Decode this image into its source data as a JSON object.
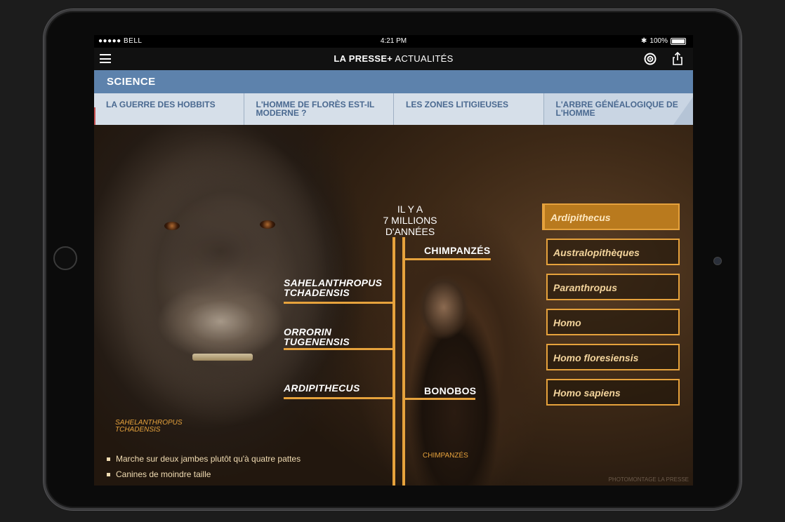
{
  "status_bar": {
    "carrier": "●●●●● BELL",
    "time": "4:21 PM",
    "battery": "100%"
  },
  "app_bar": {
    "brand_bold": "LA PRESSE+",
    "brand_light": " ACTUALITÉS"
  },
  "section": {
    "title": "SCIENCE"
  },
  "tabs": [
    {
      "label": "LA GUERRE DES HOBBITS"
    },
    {
      "label": "L'HOMME DE FLORÈS EST-IL MODERNE ?"
    },
    {
      "label": "LES ZONES LITIGIEUSES"
    },
    {
      "label": "L'ARBRE GÉNÉALOGIQUE DE L'HOMME"
    }
  ],
  "tree": {
    "root_label_line1": "IL Y A",
    "root_label_line2": "7 MILLIONS",
    "root_label_line3": "D'ANNÉES",
    "branches_left": [
      {
        "line1": "SAHELANTHROPUS",
        "line2": "TCHADENSIS"
      },
      {
        "line1": "ORRORIN",
        "line2": "TUGENENSIS"
      },
      {
        "line1": "ARDIPITHECUS",
        "line2": ""
      }
    ],
    "branches_right": [
      {
        "label": "CHIMPANZÉS"
      },
      {
        "label": "BONOBOS"
      }
    ]
  },
  "genus_list": [
    {
      "label": "Ardipithecus",
      "active": true
    },
    {
      "label": "Australopithèques",
      "active": false
    },
    {
      "label": "Paranthropus",
      "active": false
    },
    {
      "label": "Homo",
      "active": false
    },
    {
      "label": "Homo floresiensis",
      "active": false
    },
    {
      "label": "Homo sapiens",
      "active": false
    }
  ],
  "caption": {
    "line1": "SAHELANTHROPUS",
    "line2": "TCHADENSIS"
  },
  "bullets": [
    "Marche sur deux jambes plutôt qu'à quatre pattes",
    "Canines de moindre taille"
  ],
  "chimp_caption": "CHIMPANZÉS",
  "credit": "PHOTOMONTAGE LA PRESSE",
  "colors": {
    "accent": "#e6a23c",
    "section_bg": "#5d82ac",
    "tab_bg": "#d6dfe9"
  }
}
